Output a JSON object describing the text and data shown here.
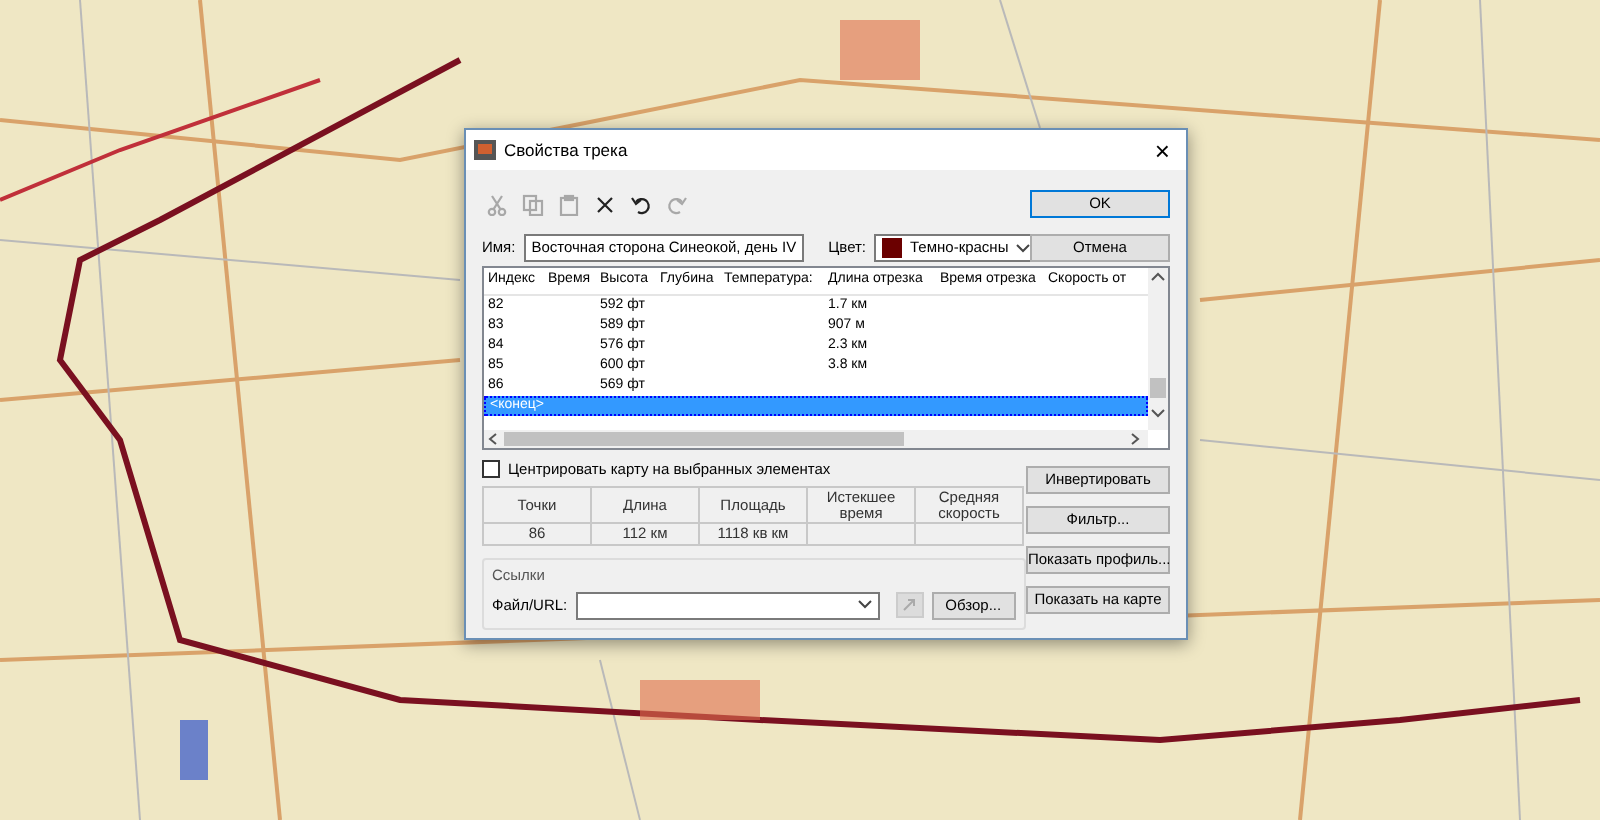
{
  "window": {
    "title": "Свойства трека",
    "close": "×"
  },
  "toolbar": [
    {
      "kind": "cut",
      "disabled": true
    },
    {
      "kind": "copy",
      "disabled": true
    },
    {
      "kind": "paste",
      "disabled": true
    },
    {
      "kind": "delete",
      "disabled": false
    },
    {
      "kind": "undo",
      "disabled": false
    },
    {
      "kind": "redo",
      "disabled": true
    }
  ],
  "name_field": {
    "label": "Имя:",
    "value": "Восточная сторона Синеокой, день IV"
  },
  "color_field": {
    "label": "Цвет:",
    "value": "Темно-красны",
    "color": "#6b0000"
  },
  "dialog_buttons": [
    {
      "label": "OK",
      "default": true
    },
    {
      "label": "Отмена",
      "default": false
    }
  ],
  "table": {
    "columns": [
      "Индекс",
      "Время",
      "Высота",
      "Глубина",
      "Температура:",
      "Длина отрезка",
      "Время отрезка",
      "Скорость от"
    ],
    "rows": [
      {
        "index": "82",
        "height": "592 фт",
        "segment_length": "1.7 км",
        "selected": false
      },
      {
        "index": "83",
        "height": "589 фт",
        "segment_length": "907 м",
        "selected": false
      },
      {
        "index": "84",
        "height": "576 фт",
        "segment_length": "2.3 км",
        "selected": false
      },
      {
        "index": "85",
        "height": "600 фт",
        "segment_length": "3.8 км",
        "selected": false
      },
      {
        "index": "86",
        "height": "569 фт",
        "selected": false
      },
      {
        "index": "<конец>",
        "selected": true
      }
    ]
  },
  "center_map": {
    "label": "Центрировать карту на выбранных элементах",
    "checked": false
  },
  "stats": {
    "columns": [
      "Точки",
      "Длина",
      "Площадь",
      "Истекшее время",
      "Средняя скорость"
    ],
    "values": [
      "86",
      "112 км",
      "1118 кв км"
    ]
  },
  "links": {
    "title": "Ссылки",
    "label": "Файл/URL:",
    "browse": "Обзор..."
  },
  "side_buttons": [
    "Инвертировать",
    "Фильтр...",
    "Показать профиль...",
    "Показать на карте"
  ]
}
